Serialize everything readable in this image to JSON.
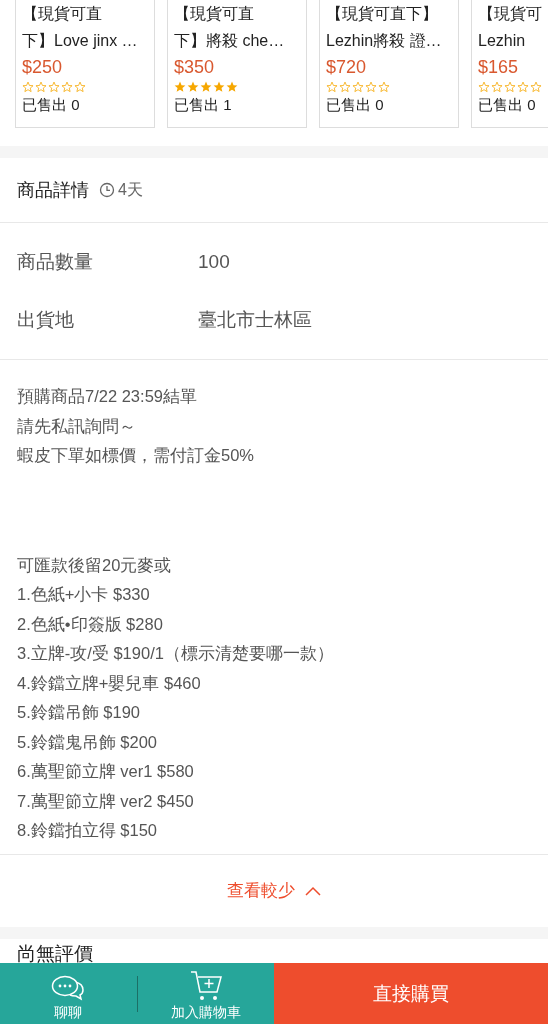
{
  "related_products": [
    {
      "title_lines": [
        "【現貨可直",
        "下】Love jinx …"
      ],
      "price": "$250",
      "stars": 0,
      "sold": "已售出 0"
    },
    {
      "title_lines": [
        "【現貨可直",
        "下】將殺 che…"
      ],
      "price": "$350",
      "stars": 5,
      "sold": "已售出 1"
    },
    {
      "title_lines": [
        "【現貨可直下】",
        "Lezhin將殺 證…"
      ],
      "price": "$720",
      "stars": 0,
      "sold": "已售出 0"
    },
    {
      "title_lines": [
        "【現貨可",
        "Lezhin"
      ],
      "price": "$165",
      "stars": 0,
      "sold": "已售出 0"
    }
  ],
  "details": {
    "title": "商品詳情",
    "time_left": "4天",
    "specs": [
      {
        "label": "商品數量",
        "value": "100"
      },
      {
        "label": "出貨地",
        "value": "臺北市士林區"
      }
    ],
    "description": [
      [
        "預購商品7/22 23:59結單",
        "請先私訊詢問～",
        "蝦皮下單如標價，需付訂金50%"
      ],
      [
        "可匯款後留20元麥或",
        "1.色紙+小卡 $330",
        "2.色紙•印簽版 $280",
        "3.立牌-攻/受 $190/1（標示清楚要哪一款）",
        "4.鈴鐺立牌+嬰兒車 $460",
        "5.鈴鐺吊飾 $190",
        "5.鈴鐺鬼吊飾 $200",
        "6.萬聖節立牌 ver1 $580",
        "7.萬聖節立牌 ver2 $450",
        "8.鈴鐺拍立得 $150"
      ]
    ],
    "toggle": "查看較少"
  },
  "reviews": {
    "title": "尚無評價"
  },
  "bottom_bar": {
    "chat": "聊聊",
    "add_to_cart": "加入購物車",
    "buy_now": "直接購買"
  }
}
